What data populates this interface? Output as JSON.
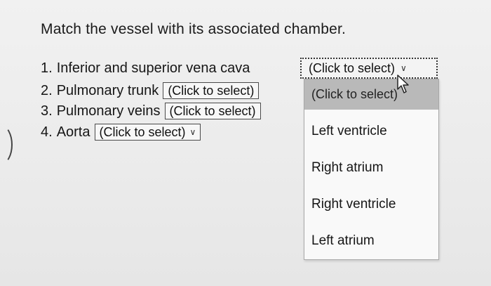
{
  "question": {
    "prompt": "Match the vessel with its associated chamber."
  },
  "items": [
    {
      "number": "1.",
      "label": "Inferior and superior vena cava",
      "selected": "(Click to select)"
    },
    {
      "number": "2.",
      "label": "Pulmonary trunk",
      "selected": "(Click to select)"
    },
    {
      "number": "3.",
      "label": "Pulmonary veins",
      "selected": "(Click to select)"
    },
    {
      "number": "4.",
      "label": "Aorta",
      "selected": "(Click to select)"
    }
  ],
  "dropdown": {
    "highlighted": "(Click to select)",
    "options": [
      "Left ventricle",
      "Right atrium",
      "Right ventricle",
      "Left atrium"
    ]
  },
  "icons": {
    "chevron": "chevron-down-icon",
    "cursor": "mouse-cursor-icon"
  },
  "colors": {
    "background": "#ececec",
    "highlight": "#b9b9b9",
    "border": "#4a4a4a"
  }
}
